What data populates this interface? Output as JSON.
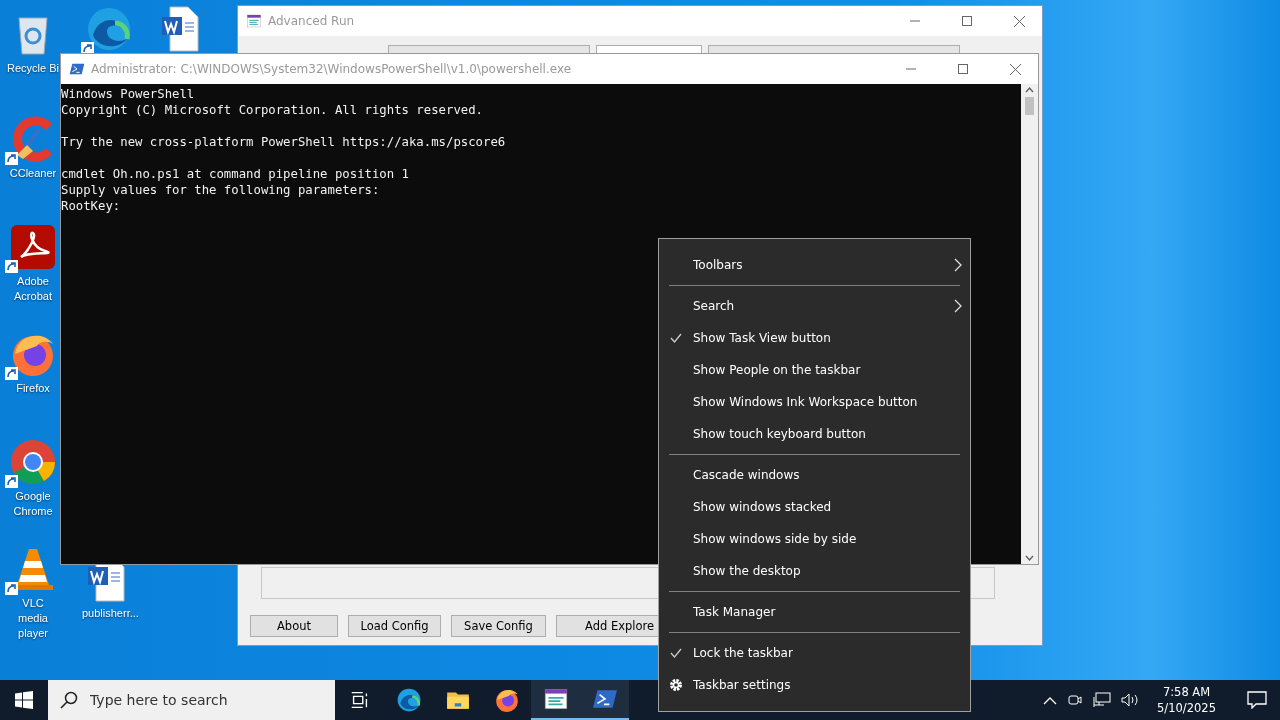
{
  "desktop": {
    "icons": [
      {
        "kind": "recycle",
        "label": "Recycle Bi",
        "shortcut": false
      },
      {
        "kind": "ccleaner",
        "label": "CCleaner",
        "shortcut": true
      },
      {
        "kind": "acrobat",
        "label": "Adobe Acrobat",
        "shortcut": true
      },
      {
        "kind": "firefox",
        "label": "Firefox",
        "shortcut": true
      },
      {
        "kind": "chrome",
        "label": "Google Chrome",
        "shortcut": true
      },
      {
        "kind": "vlc",
        "label": "VLC media player",
        "shortcut": true
      },
      {
        "kind": "edge",
        "shortcut": true
      },
      {
        "kind": "word",
        "shortcut": false
      },
      {
        "kind": "word",
        "label": "publisherr...",
        "shortcut": false
      }
    ]
  },
  "advanced_run": {
    "title": "Advanced Run",
    "buttons": [
      "About",
      "Load Config",
      "Save Config",
      "Add Explore"
    ]
  },
  "powershell": {
    "title": "Administrator: C:\\WINDOWS\\System32\\WindowsPowerShell\\v1.0\\powershell.exe",
    "console": [
      [
        "Windows PowerShell",
        "Copyright (C) Microsoft Corporation. All rights reserved."
      ],
      [
        "Try the new cross-platform PowerShell https://aka.ms/pscore6"
      ],
      [
        "cmdlet Oh.no.ps1 at command pipeline position 1",
        "Supply values for the following parameters:",
        "RootKey:"
      ]
    ]
  },
  "context_menu": {
    "groups": [
      [
        {
          "kind": "submenu",
          "label": "Toolbars",
          "checked": false
        }
      ],
      [
        {
          "kind": "submenu",
          "label": "Search",
          "checked": false
        },
        {
          "kind": "item",
          "label": "Show Task View button",
          "checked": true
        },
        {
          "kind": "item",
          "label": "Show People on the taskbar",
          "checked": false
        },
        {
          "kind": "item",
          "label": "Show Windows Ink Workspace button",
          "checked": false
        },
        {
          "kind": "item",
          "label": "Show touch keyboard button",
          "checked": false
        }
      ],
      [
        {
          "kind": "item",
          "label": "Cascade windows",
          "checked": false
        },
        {
          "kind": "item",
          "label": "Show windows stacked",
          "checked": false
        },
        {
          "kind": "item",
          "label": "Show windows side by side",
          "checked": false
        },
        {
          "kind": "item",
          "label": "Show the desktop",
          "checked": false
        }
      ],
      [
        {
          "kind": "item",
          "label": "Task Manager",
          "checked": false
        }
      ],
      [
        {
          "kind": "item",
          "label": "Lock the taskbar",
          "checked": true
        },
        {
          "kind": "settings",
          "label": "Taskbar settings",
          "checked": false
        }
      ]
    ]
  },
  "taskbar": {
    "search": {
      "placeholder": "Type here to search"
    },
    "apps": [
      {
        "kind": "taskview",
        "active": false
      },
      {
        "kind": "edge",
        "active": false
      },
      {
        "kind": "explorer",
        "active": false
      },
      {
        "kind": "firefox",
        "active": false
      },
      {
        "kind": "advancedrun",
        "active": true
      },
      {
        "kind": "powershell",
        "active": true
      }
    ],
    "tray": {
      "time": "7:58 AM",
      "date": "5/10/2025"
    }
  }
}
